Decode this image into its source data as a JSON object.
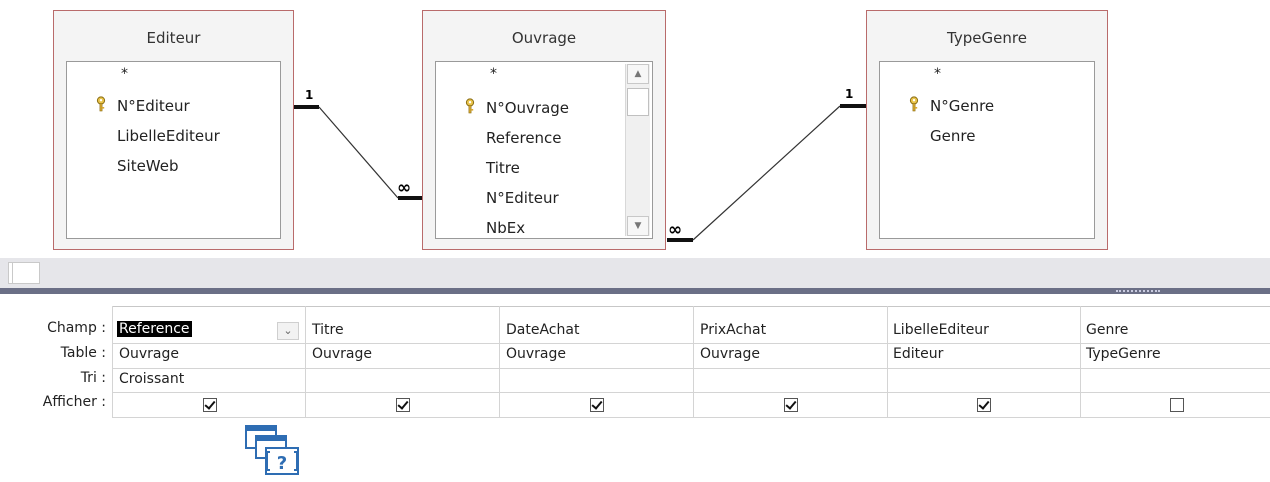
{
  "diagram": {
    "tables": [
      {
        "id": "editeur",
        "title": "Editeur",
        "fields": [
          "*",
          "N°Editeur",
          "LibelleEditeur",
          "SiteWeb"
        ],
        "key_field": "N°Editeur"
      },
      {
        "id": "ouvrage",
        "title": "Ouvrage",
        "fields": [
          "*",
          "N°Ouvrage",
          "Reference",
          "Titre",
          "N°Editeur",
          "NbEx"
        ],
        "key_field": "N°Ouvrage"
      },
      {
        "id": "typegenre",
        "title": "TypeGenre",
        "fields": [
          "*",
          "N°Genre",
          "Genre"
        ],
        "key_field": "N°Genre"
      }
    ],
    "relations": [
      {
        "from": "Editeur",
        "to": "Ouvrage",
        "one_label": "1",
        "many_label": "∞"
      },
      {
        "from": "TypeGenre",
        "to": "Ouvrage",
        "one_label": "1",
        "many_label": "∞"
      }
    ],
    "scroll_up_glyph": "▲",
    "scroll_down_glyph": "▼"
  },
  "grid": {
    "row_labels": {
      "champ": "Champ :",
      "table": "Table :",
      "tri": "Tri :",
      "afficher": "Afficher :"
    },
    "dropdown_glyph": "⌄",
    "columns": [
      {
        "champ": "Reference",
        "table": "Ouvrage",
        "tri": "Croissant",
        "afficher": true,
        "selected": true
      },
      {
        "champ": "Titre",
        "table": "Ouvrage",
        "tri": "",
        "afficher": true,
        "selected": false
      },
      {
        "champ": "DateAchat",
        "table": "Ouvrage",
        "tri": "",
        "afficher": true,
        "selected": false
      },
      {
        "champ": "PrixAchat",
        "table": "Ouvrage",
        "tri": "",
        "afficher": true,
        "selected": false
      },
      {
        "champ": "LibelleEditeur",
        "table": "Editeur",
        "tri": "",
        "afficher": true,
        "selected": false
      },
      {
        "champ": "Genre",
        "table": "TypeGenre",
        "tri": "",
        "afficher": false,
        "selected": false
      }
    ]
  },
  "icons": {
    "key": "key-icon",
    "help": "query-help-icon",
    "help_glyph": "?"
  },
  "colors": {
    "table_border": "#b96b6b",
    "splitter": "#6b6f86",
    "help_icon": "#2e6db3",
    "selection": "#000000"
  }
}
